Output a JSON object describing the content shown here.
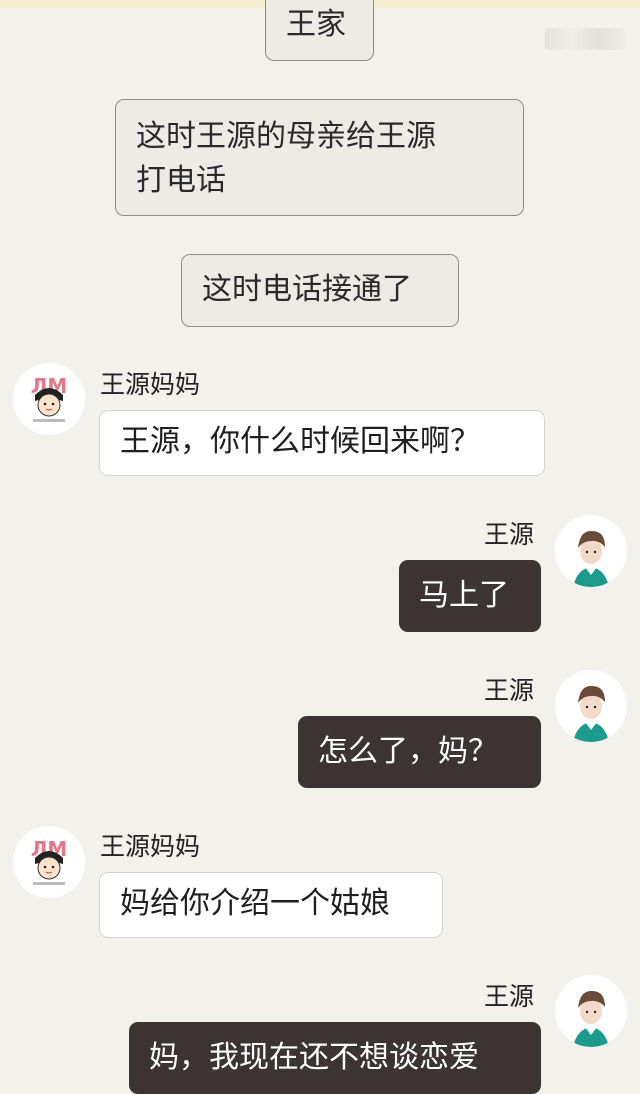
{
  "colors": {
    "background": "#f3f1ec",
    "narration_bubble": "#edebe6",
    "incoming_bubble": "#ffffff",
    "outgoing_bubble": "#3c3432"
  },
  "scene": {
    "location": "王家",
    "line1": "这时王源的母亲给王源",
    "line2": "打电话",
    "connected": "这时电话接通了"
  },
  "messages": [
    {
      "sender": "王源妈妈",
      "text": "王源，你什么时候回来啊？",
      "avatar": "cartoon-girl-avatar"
    },
    {
      "sender": "王源",
      "text": "马上了",
      "avatar": "boy-avatar"
    },
    {
      "sender": "王源",
      "text": "怎么了，妈？",
      "avatar": "boy-avatar"
    },
    {
      "sender": "王源妈妈",
      "text": "妈给你介绍一个姑娘",
      "avatar": "cartoon-girl-avatar"
    },
    {
      "sender": "王源",
      "text": "妈，我现在还不想谈恋爱",
      "avatar": "boy-avatar"
    }
  ]
}
